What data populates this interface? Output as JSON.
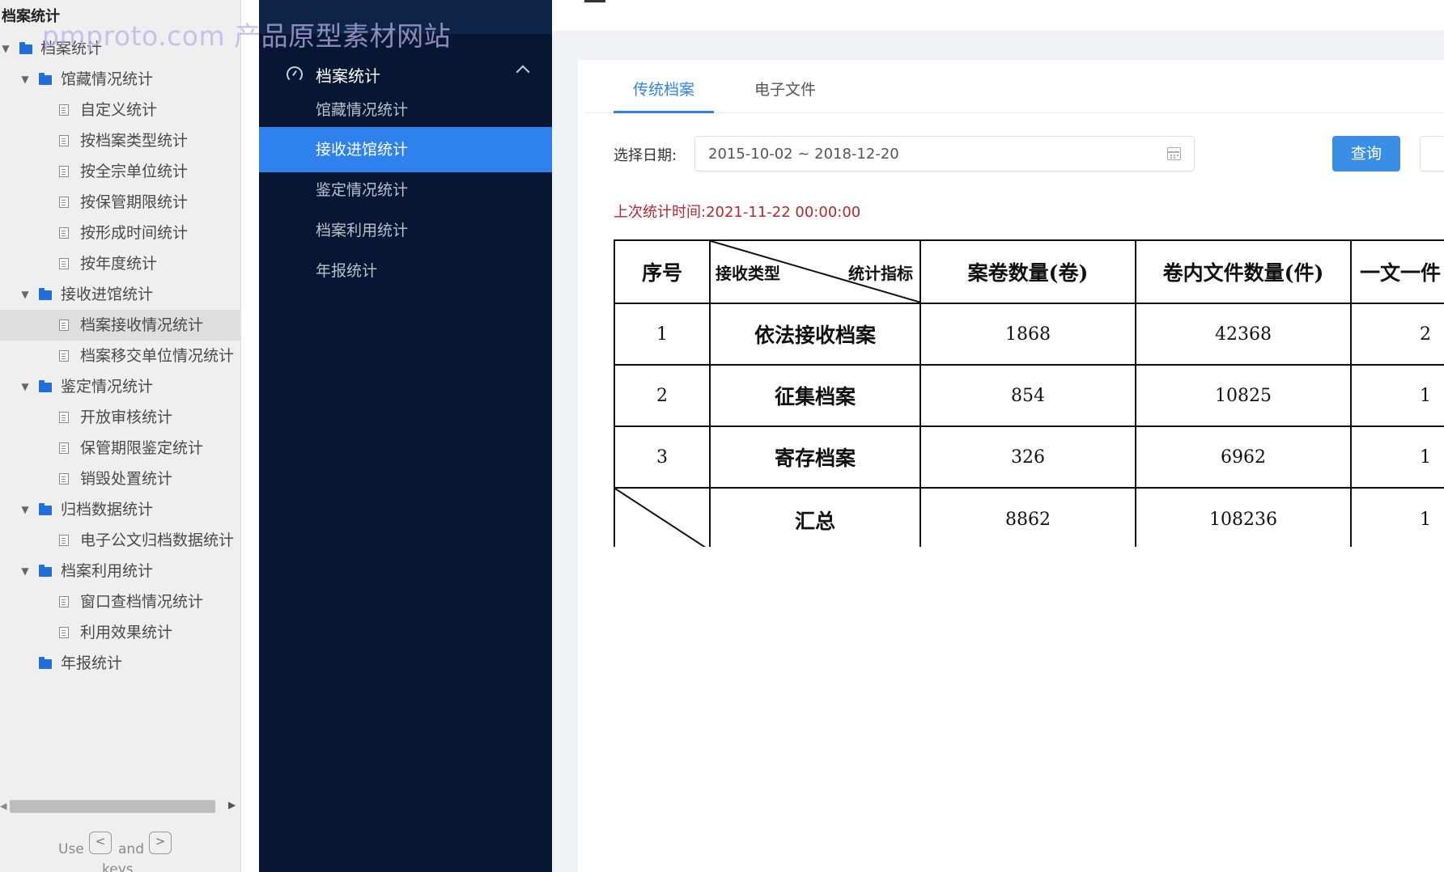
{
  "watermark": "pmproto.com 产品原型素材网站",
  "tree": {
    "title": "档案统计",
    "items": [
      {
        "label": "档案统计",
        "level": 0,
        "kind": "folder",
        "expanded": true
      },
      {
        "label": "馆藏情况统计",
        "level": 1,
        "kind": "folder",
        "expanded": true
      },
      {
        "label": "自定义统计",
        "level": 2,
        "kind": "file"
      },
      {
        "label": "按档案类型统计",
        "level": 2,
        "kind": "file"
      },
      {
        "label": "按全宗单位统计",
        "level": 2,
        "kind": "file"
      },
      {
        "label": "按保管期限统计",
        "level": 2,
        "kind": "file"
      },
      {
        "label": "按形成时间统计",
        "level": 2,
        "kind": "file"
      },
      {
        "label": "按年度统计",
        "level": 2,
        "kind": "file"
      },
      {
        "label": "接收进馆统计",
        "level": 1,
        "kind": "folder",
        "expanded": true
      },
      {
        "label": "档案接收情况统计",
        "level": 2,
        "kind": "file",
        "selected": true
      },
      {
        "label": "档案移交单位情况统计",
        "level": 2,
        "kind": "file"
      },
      {
        "label": "鉴定情况统计",
        "level": 1,
        "kind": "folder",
        "expanded": true
      },
      {
        "label": "开放审核统计",
        "level": 2,
        "kind": "file"
      },
      {
        "label": "保管期限鉴定统计",
        "level": 2,
        "kind": "file"
      },
      {
        "label": "销毁处置统计",
        "level": 2,
        "kind": "file"
      },
      {
        "label": "归档数据统计",
        "level": 1,
        "kind": "folder",
        "expanded": true
      },
      {
        "label": "电子公文归档数据统计",
        "level": 2,
        "kind": "file"
      },
      {
        "label": "档案利用统计",
        "level": 1,
        "kind": "folder",
        "expanded": true
      },
      {
        "label": "窗口查档情况统计",
        "level": 2,
        "kind": "file"
      },
      {
        "label": "利用效果统计",
        "level": 2,
        "kind": "file"
      },
      {
        "label": "年报统计",
        "level": 1,
        "kind": "folder",
        "expanded": false
      }
    ],
    "hint": {
      "use": "Use",
      "key1": "<",
      "and": "and",
      "key2": ">",
      "keys": "keys"
    }
  },
  "nav": {
    "section_title": "档案统计",
    "items": [
      {
        "label": "馆藏情况统计",
        "active": false
      },
      {
        "label": "接收进馆统计",
        "active": true
      },
      {
        "label": "鉴定情况统计",
        "active": false
      },
      {
        "label": "档案利用统计",
        "active": false
      },
      {
        "label": "年报统计",
        "active": false
      }
    ]
  },
  "tabs": [
    {
      "label": "传统档案",
      "active": true
    },
    {
      "label": "电子文件",
      "active": false
    }
  ],
  "filter": {
    "date_label": "选择日期:",
    "date_value": "2015-10-02 ~ 2018-12-20",
    "query_button": "查询"
  },
  "last_stat_time": "上次统计时间:2021-11-22 00:00:00",
  "report": {
    "headers": {
      "seq": "序号",
      "diag_left": "接收类型",
      "diag_right": "统计指标",
      "volumes": "案卷数量(卷)",
      "files": "卷内文件数量(件)",
      "one_doc": "一文一件"
    },
    "rows": [
      {
        "seq": "1",
        "type": "依法接收档案",
        "volumes": "1868",
        "files": "42368",
        "one_doc": "2"
      },
      {
        "seq": "2",
        "type": "征集档案",
        "volumes": "854",
        "files": "10825",
        "one_doc": "1"
      },
      {
        "seq": "3",
        "type": "寄存档案",
        "volumes": "326",
        "files": "6962",
        "one_doc": "1"
      }
    ],
    "total": {
      "label": "汇总",
      "volumes": "8862",
      "files": "108236",
      "one_doc": "1"
    }
  },
  "colors": {
    "nav_bg": "#061633",
    "nav_active": "#2f82ed",
    "accent": "#2f82ed",
    "last_time": "#b5282d",
    "folder": "#1e6fd9"
  }
}
